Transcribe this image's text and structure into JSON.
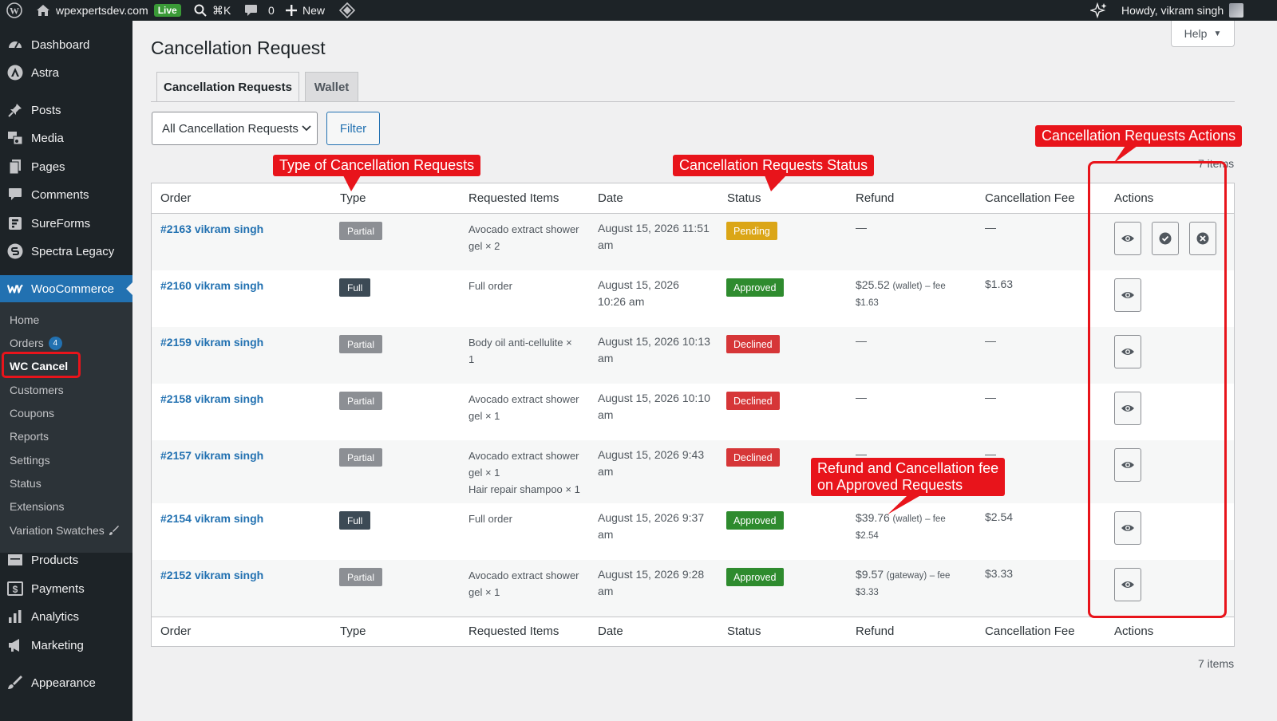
{
  "adminbar": {
    "site_name": "wpexpertsdev.com",
    "live_label": "Live",
    "search_shortcut": "⌘K",
    "comments_count": "0",
    "new_label": "New",
    "greeting": "Howdy, vikram singh"
  },
  "sidebar": {
    "top_items": [
      {
        "label": "Dashboard",
        "icon": "dashboard-icon"
      },
      {
        "label": "Astra",
        "icon": "astra-icon"
      },
      {
        "label": "Posts",
        "icon": "pin-icon"
      },
      {
        "label": "Media",
        "icon": "media-icon"
      },
      {
        "label": "Pages",
        "icon": "pages-icon"
      },
      {
        "label": "Comments",
        "icon": "comments-icon"
      },
      {
        "label": "SureForms",
        "icon": "sureforms-icon"
      },
      {
        "label": "Spectra Legacy",
        "icon": "spectra-icon"
      },
      {
        "label": "WooCommerce",
        "icon": "woo-icon"
      }
    ],
    "submenu": [
      {
        "label": "Home"
      },
      {
        "label": "Orders",
        "badge": "4"
      },
      {
        "label": "WC Cancel"
      },
      {
        "label": "Customers"
      },
      {
        "label": "Coupons"
      },
      {
        "label": "Reports"
      },
      {
        "label": "Settings"
      },
      {
        "label": "Status"
      },
      {
        "label": "Extensions"
      },
      {
        "label": "Variation Swatches"
      }
    ],
    "bottom_items": [
      {
        "label": "Products",
        "icon": "products-icon"
      },
      {
        "label": "Payments",
        "icon": "payments-icon"
      },
      {
        "label": "Analytics",
        "icon": "analytics-icon"
      },
      {
        "label": "Marketing",
        "icon": "marketing-icon"
      },
      {
        "label": "Appearance",
        "icon": "appearance-icon"
      }
    ]
  },
  "help_label": "Help",
  "page_title": "Cancellation Request",
  "tabs": [
    {
      "label": "Cancellation Requests",
      "active": true
    },
    {
      "label": "Wallet",
      "active": false
    }
  ],
  "filter": {
    "selected": "All Cancellation Requests",
    "button": "Filter"
  },
  "items_count": "7 items",
  "table": {
    "columns": [
      "Order",
      "Type",
      "Requested Items",
      "Date",
      "Status",
      "Refund",
      "Cancellation Fee",
      "Actions"
    ],
    "rows": [
      {
        "order": "#2163 vikram singh",
        "type": "Partial",
        "items": [
          "Avocado extract shower",
          "gel × 2"
        ],
        "date": [
          "August 15, 2026 11:51",
          "am"
        ],
        "status": "Pending",
        "refund": "—",
        "refund_fee": "",
        "refund_method": "",
        "fee": "—",
        "actions": [
          "view",
          "approve",
          "decline"
        ]
      },
      {
        "order": "#2160 vikram singh",
        "type": "Full",
        "items": [
          "Full order"
        ],
        "date": [
          "August 15, 2026",
          "10:26 am"
        ],
        "status": "Approved",
        "refund": "$25.52",
        "refund_method": "(wallet)",
        "refund_fee_label": "– fee",
        "refund_fee": "$1.63",
        "fee": "$1.63",
        "actions": [
          "view"
        ]
      },
      {
        "order": "#2159 vikram singh",
        "type": "Partial",
        "items": [
          "Body oil anti-cellulite ×",
          "1"
        ],
        "date": [
          "August 15, 2026 10:13",
          "am"
        ],
        "status": "Declined",
        "refund": "—",
        "refund_fee": "",
        "refund_method": "",
        "fee": "—",
        "actions": [
          "view"
        ]
      },
      {
        "order": "#2158 vikram singh",
        "type": "Partial",
        "items": [
          "Avocado extract shower",
          "gel × 1"
        ],
        "date": [
          "August 15, 2026 10:10",
          "am"
        ],
        "status": "Declined",
        "refund": "—",
        "refund_fee": "",
        "refund_method": "",
        "fee": "—",
        "actions": [
          "view"
        ]
      },
      {
        "order": "#2157 vikram singh",
        "type": "Partial",
        "items": [
          "Avocado extract shower",
          "gel × 1",
          "Hair repair shampoo × 1"
        ],
        "date": [
          "August 15, 2026 9:43",
          "am"
        ],
        "status": "Declined",
        "refund": "—",
        "refund_fee": "",
        "refund_method": "",
        "fee": "—",
        "actions": [
          "view"
        ]
      },
      {
        "order": "#2154 vikram singh",
        "type": "Full",
        "items": [
          "Full order"
        ],
        "date": [
          "August 15, 2026 9:37",
          "am"
        ],
        "status": "Approved",
        "refund": "$39.76",
        "refund_method": "(wallet)",
        "refund_fee_label": "– fee",
        "refund_fee": "$2.54",
        "fee": "$2.54",
        "actions": [
          "view"
        ]
      },
      {
        "order": "#2152 vikram singh",
        "type": "Partial",
        "items": [
          "Avocado extract shower",
          "gel × 1"
        ],
        "date": [
          "August 15, 2026 9:28",
          "am"
        ],
        "status": "Approved",
        "refund": "$9.57",
        "refund_method": "(gateway)",
        "refund_fee_label": "– fee",
        "refund_fee": "$3.33",
        "fee": "$3.33",
        "actions": [
          "view"
        ]
      }
    ]
  },
  "annotations": {
    "type_label": "Type of Cancellation Requests",
    "status_label": "Cancellation Requests Status",
    "actions_label": "Cancellation Requests Actions",
    "refund_label_line1": "Refund and Cancellation fee",
    "refund_label_line2": "on Approved Requests"
  },
  "colors": {
    "partial": "#8c8f94",
    "full": "#3c4a55",
    "pending": "#dba617",
    "approved": "#2e8b2e",
    "declined": "#d63638",
    "annotation": "#e8141b",
    "link": "#2271b1"
  }
}
